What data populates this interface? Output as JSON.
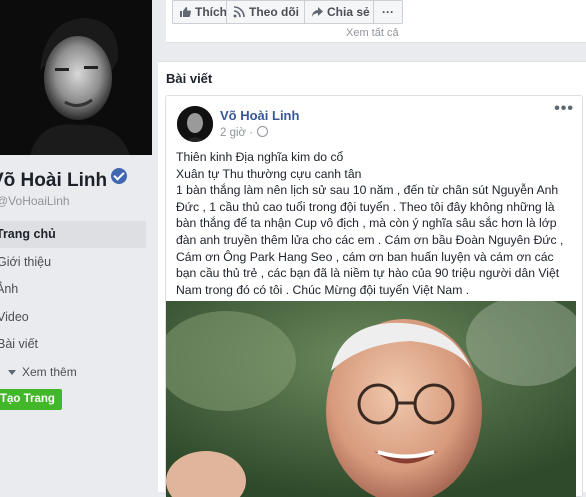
{
  "profile": {
    "name": "Võ Hoài Linh",
    "handle": "@VoHoaiLinh"
  },
  "nav": {
    "items": [
      "Trang chủ",
      "Giới thiệu",
      "Ảnh",
      "Video",
      "Bài viết"
    ],
    "more": "Xem thêm",
    "create_page": "Tạo Trang"
  },
  "actions": {
    "like": "Thích",
    "follow": "Theo dõi",
    "share": "Chia sẻ",
    "more": "···",
    "see_all": "Xem tất cả"
  },
  "posts_section": {
    "title": "Bài viết"
  },
  "post": {
    "author": "Võ Hoài Linh",
    "time": "2 giờ ·",
    "lines": [
      "Thiên kinh Địa nghĩa kim do cổ",
      "Xuân tự Thu thường cựu canh tân",
      "1 bàn thắng làm nên lịch sử sau 10 năm , đến từ chân sút Nguyễn Anh",
      "Đức , 1 cầu thủ cao tuổi trong đội tuyển . Theo tôi đây không những là",
      "bàn thắng để ta nhận Cup vô địch , mà còn ý nghĩa sâu sắc hơn là lớp",
      "đàn anh truyền thêm lửa cho các em . Cám ơn bầu Đoàn Nguyên Đức ,",
      "Cám ơn Ông Park Hang Seo , cám ơn ban huấn luyện và cám ơn các",
      "bạn cầu thủ trẻ , các bạn đã là niềm tự hào của 90 triệu người dân Việt",
      "Nam trong đó có tôi . Chúc Mừng đội tuyển Việt Nam ."
    ],
    "menu": "•••"
  },
  "colors": {
    "link": "#365899",
    "green_button": "#42b72a",
    "background": "#e9ebee"
  }
}
